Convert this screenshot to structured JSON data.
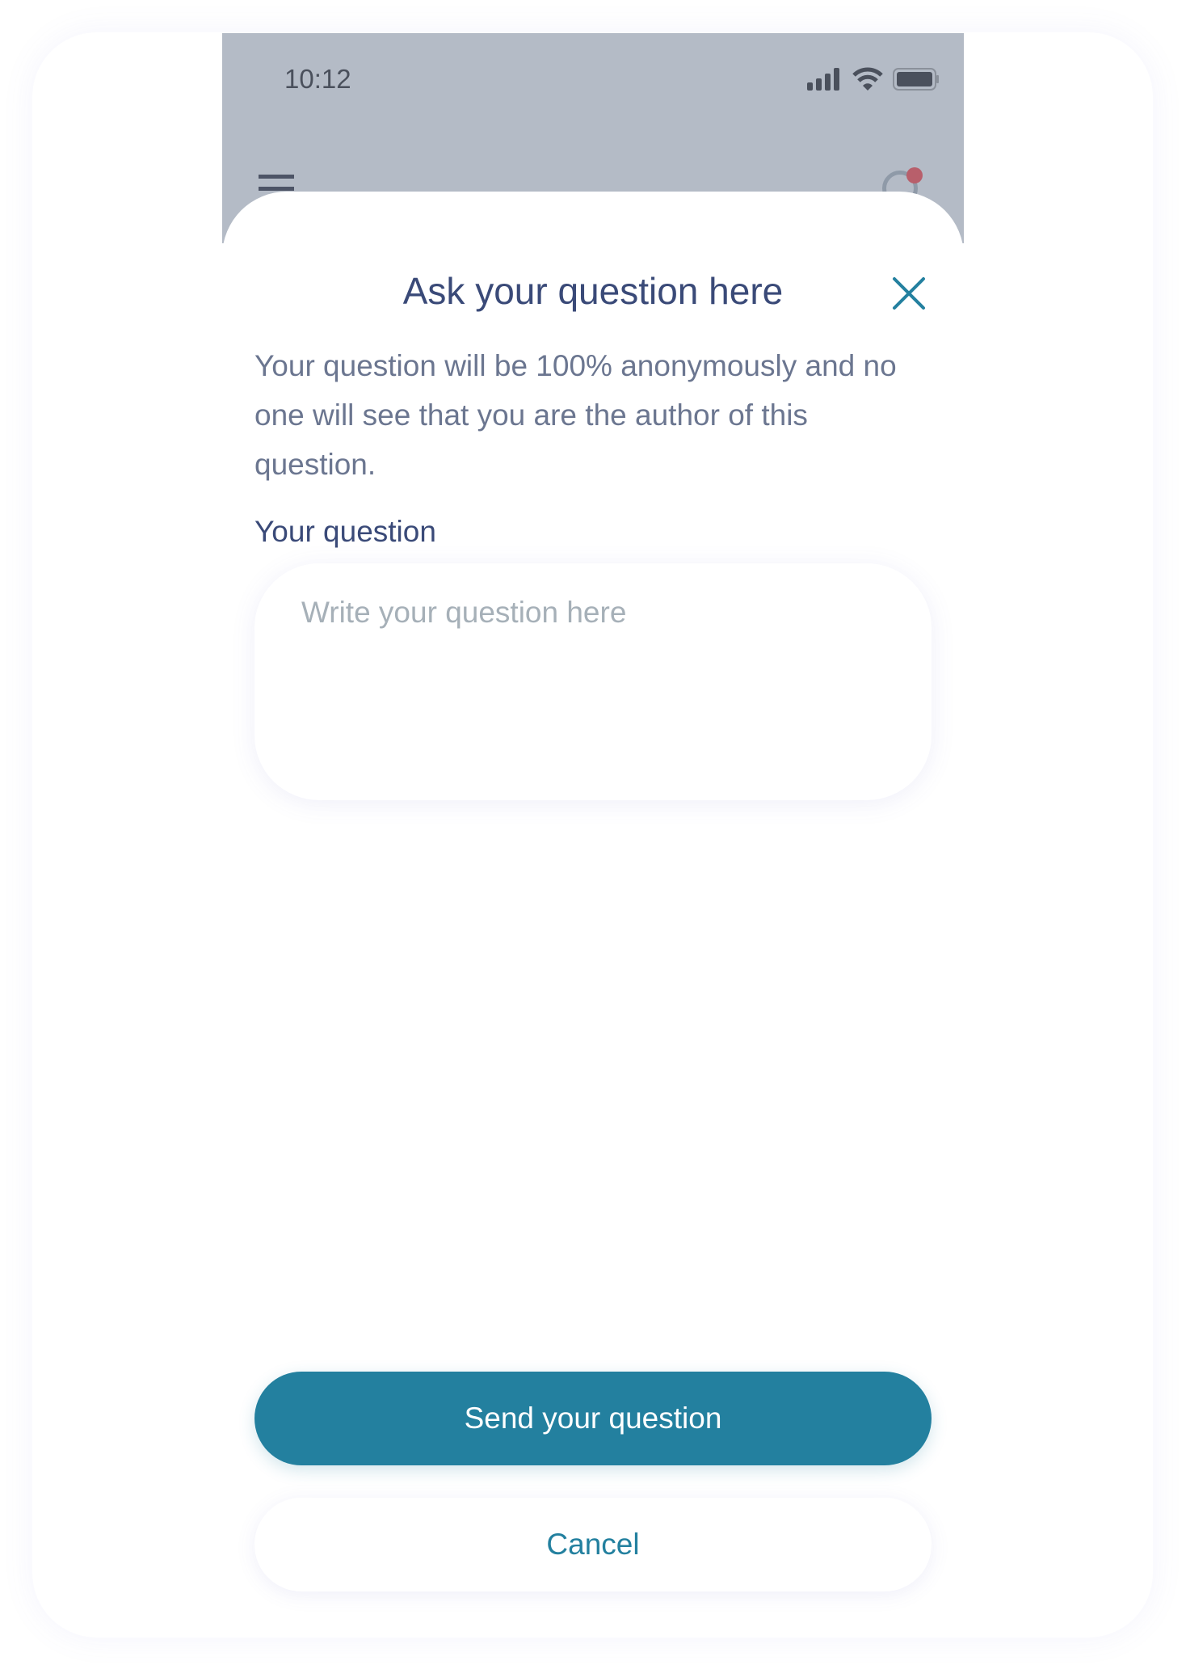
{
  "status_bar": {
    "time": "10:12"
  },
  "dialog": {
    "title": "Ask your question here",
    "description": "Your question will be 100% anonymously and no one will see that you are the author of this question.",
    "field_label": "Your question",
    "field_placeholder": "Write your question here",
    "field_value": "",
    "send_label": "Send your question",
    "cancel_label": "Cancel"
  },
  "colors": {
    "accent": "#23809f",
    "title": "#3a4a78",
    "notification": "#b85f6b"
  }
}
